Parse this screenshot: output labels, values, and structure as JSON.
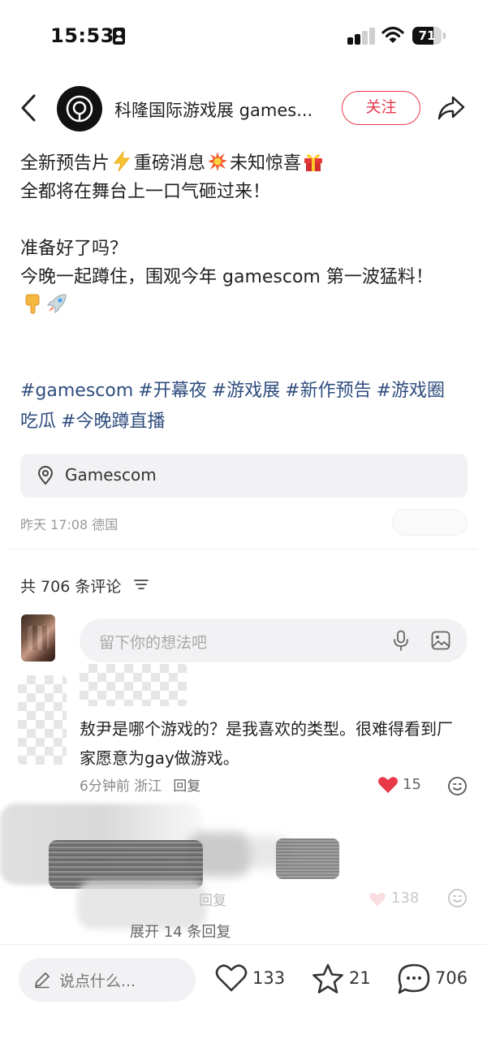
{
  "status_bar": {
    "time": "15:53",
    "battery": "71",
    "battery_level_percent": 71,
    "icons": [
      "id-card-icon",
      "signal-icon",
      "wifi-icon",
      "battery-icon"
    ]
  },
  "header": {
    "author_name": "科隆国际游戏展 games...",
    "follow_label": "关注",
    "icons": [
      "back-chevron-icon",
      "gamescom-logo-icon",
      "share-icon"
    ]
  },
  "post": {
    "line1_a": "全新预告片",
    "line1_b": "重磅消息",
    "line1_c": "未知惊喜",
    "line2": "全都将在舞台上一口气砸过来！",
    "line3": "准备好了吗？",
    "line4": "今晚一起蹲住，围观今年 gamescom 第一波猛料！",
    "emoji_icons": [
      "lightning-emoji",
      "collision-emoji",
      "gift-emoji",
      "pointing-down-emoji",
      "rocket-emoji"
    ]
  },
  "tags": [
    "#gamescom",
    "#开幕夜",
    "#游戏展",
    "#新作预告",
    "#游戏圈",
    "吃瓜",
    "#今晚蹲直播"
  ],
  "location": {
    "label": "Gamescom"
  },
  "meta": {
    "date_place": "昨天 17:08 德国"
  },
  "comments_header": {
    "count_label": "共 706 条评论"
  },
  "comment_input": {
    "placeholder": "留下你的想法吧"
  },
  "comments": [
    {
      "text": "敖尹是哪个游戏的？是我喜欢的类型。很难得看到厂家愿意为gay做游戏。",
      "time_place": "6分钟前 浙江",
      "reply_label": "回复",
      "likes": "15",
      "liked": true
    },
    {
      "reply_label": "回复",
      "likes": "138"
    }
  ],
  "expand_replies": "展开 14 条回复",
  "bottom_bar": {
    "say_placeholder": "说点什么...",
    "likes": "133",
    "favorites": "21",
    "comments": "706"
  },
  "colors": {
    "accent_red": "#e8394a",
    "tag_blue": "#2f4d7e",
    "input_bg": "#f2f2f4"
  }
}
